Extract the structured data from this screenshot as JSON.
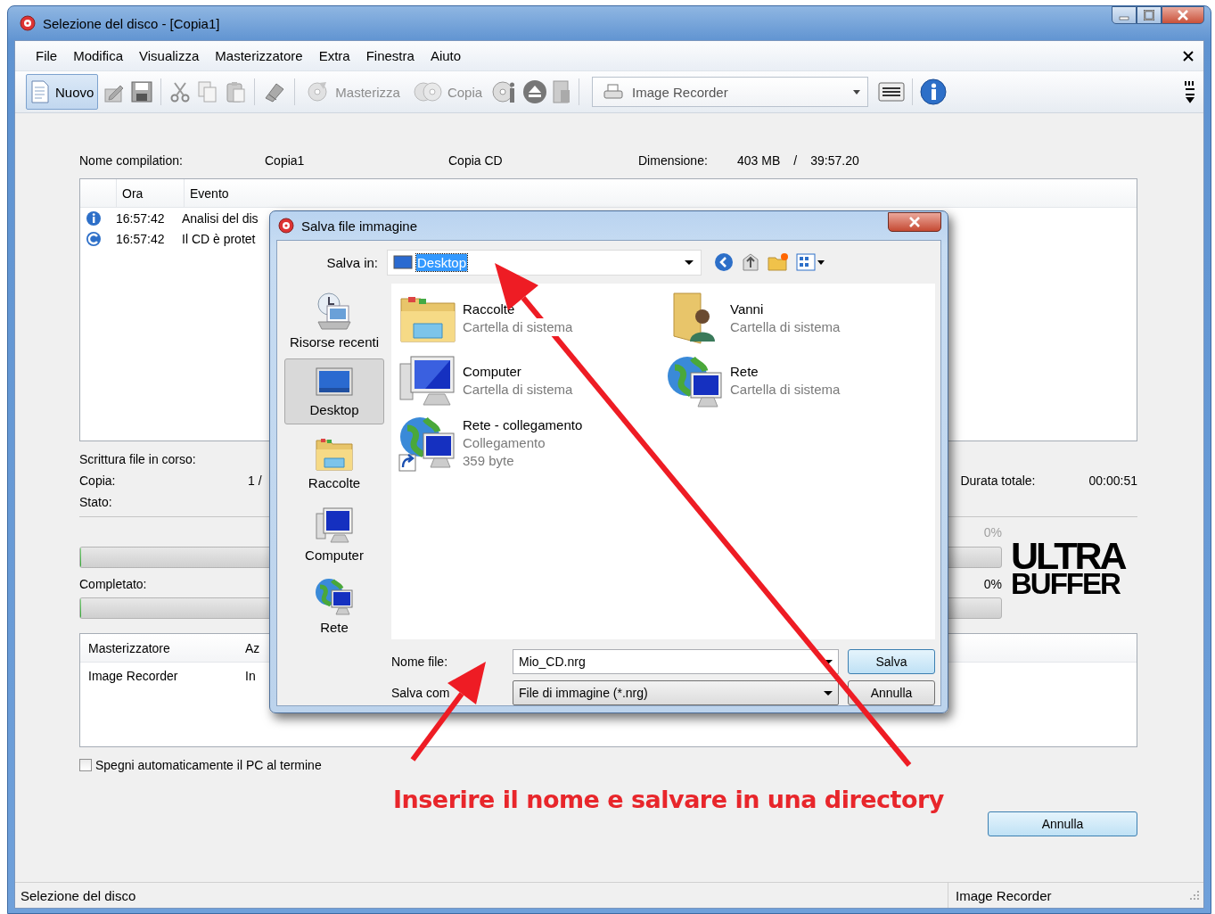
{
  "window": {
    "title": "Selezione del disco - [Copia1]"
  },
  "menu": [
    "File",
    "Modifica",
    "Visualizza",
    "Masterizzatore",
    "Extra",
    "Finestra",
    "Aiuto"
  ],
  "toolbar": {
    "buttons": [
      {
        "kind": "new",
        "label": "Nuovo",
        "highlighted": true,
        "disabled": false
      },
      {
        "kind": "burn",
        "label": "Masterizza",
        "highlighted": false,
        "disabled": true
      },
      {
        "kind": "copy",
        "label": "Copia",
        "highlighted": false,
        "disabled": true
      }
    ],
    "recorder": "Image Recorder"
  },
  "compilation": {
    "name_label": "Nome compilation:",
    "name": "Copia1",
    "type": "Copia CD",
    "size_label": "Dimensione:",
    "size": "403 MB",
    "separator": "/",
    "duration": "39:57.20"
  },
  "log": {
    "columns": [
      "Ora",
      "Evento"
    ],
    "rows": [
      {
        "kind": "info",
        "time": "16:57:42",
        "event": "Analisi del dis"
      },
      {
        "kind": "disc",
        "time": "16:57:42",
        "event": "Il CD è protet"
      }
    ]
  },
  "progress": {
    "writing_label": "Scrittura file in corso:",
    "copy_label": "Copia:",
    "copy_value": "1 /",
    "status_label": "Stato:",
    "total_duration_label": "Durata totale:",
    "total_duration": "00:00:51",
    "buffer": {
      "percent": "0%",
      "level": 0
    },
    "completed_label": "Completato:",
    "completed": {
      "percent": "0%",
      "level": 0
    }
  },
  "logo": {
    "line_1": "ULTRA",
    "line_2": "BUFFER"
  },
  "recorders": {
    "columns": [
      "Masterizzatore",
      "Az"
    ],
    "rows": [
      [
        "Image Recorder",
        "In"
      ]
    ]
  },
  "shutdown": {
    "label": "Spegni automaticamente il PC al termine",
    "checked": false
  },
  "cancel_button": "Annulla",
  "status_bar": [
    "Selezione del disco",
    "Image Recorder"
  ],
  "dialog": {
    "title": "Salva file immagine",
    "save_in_label": "Salva in:",
    "location": "Desktop",
    "places": [
      {
        "kind": "recent",
        "label": "Risorse recenti",
        "selected": false
      },
      {
        "kind": "desktop",
        "label": "Desktop",
        "selected": true
      },
      {
        "kind": "libraries",
        "label": "Raccolte",
        "selected": false
      },
      {
        "kind": "computer",
        "label": "Computer",
        "selected": false
      },
      {
        "kind": "network",
        "label": "Rete",
        "selected": false
      }
    ],
    "items": [
      {
        "kind": "libraries",
        "name": "Raccolte",
        "details": [
          "Cartella di sistema"
        ]
      },
      {
        "kind": "user",
        "name": "Vanni",
        "details": [
          "Cartella di sistema"
        ]
      },
      {
        "kind": "computer",
        "name": "Computer",
        "details": [
          "Cartella di sistema"
        ]
      },
      {
        "kind": "network",
        "name": "Rete",
        "details": [
          "Cartella di sistema"
        ]
      },
      {
        "kind": "shortcut",
        "name": "Rete - collegamento",
        "details": [
          "Collegamento",
          "359 byte"
        ]
      }
    ],
    "file_name_label": "Nome file:",
    "file_name": "Mio_CD.nrg",
    "save_as_label": "Salva com",
    "file_type": "File di immagine (*.nrg)",
    "save_button": "Salva",
    "cancel_button": "Annulla"
  },
  "annotation": {
    "caption": "Inserire il nome e salvare in una directory"
  }
}
